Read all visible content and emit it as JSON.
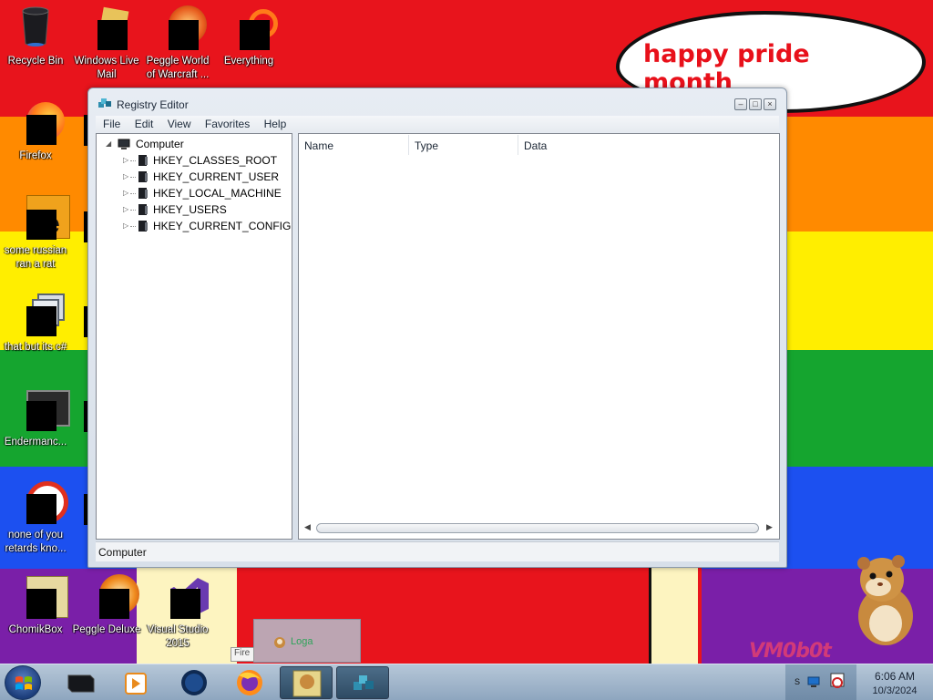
{
  "speech_bubble": {
    "text": "happy pride month"
  },
  "watermark": "VM0b0t",
  "desktop_icons": [
    {
      "label": "Recycle Bin"
    },
    {
      "label": "Windows Live Mail"
    },
    {
      "label": "Peggle World of Warcraft ..."
    },
    {
      "label": "Everything"
    },
    {
      "label": "Firefox"
    },
    {
      "label": "some russian ran a rat"
    },
    {
      "label": "that but its c#"
    },
    {
      "label": "Endermanc..."
    },
    {
      "label": "none of you retards kno..."
    },
    {
      "label": "ChomikBox"
    },
    {
      "label": "Peggle Deluxe"
    },
    {
      "label": "Visual Studio 2015"
    }
  ],
  "regedit": {
    "title": "Registry Editor",
    "menu": [
      "File",
      "Edit",
      "View",
      "Favorites",
      "Help"
    ],
    "tree": {
      "root": "Computer",
      "hives": [
        "HKEY_CLASSES_ROOT",
        "HKEY_CURRENT_USER",
        "HKEY_LOCAL_MACHINE",
        "HKEY_USERS",
        "HKEY_CURRENT_CONFIG"
      ]
    },
    "columns": [
      "Name",
      "Type",
      "Data"
    ],
    "status": "Computer"
  },
  "drag_preview": {
    "label": "Loga",
    "tooltip": "Fire"
  },
  "taskbar": {
    "items": [
      "terminal",
      "media-player",
      "globe",
      "firefox",
      "chomikbox",
      "regedit"
    ],
    "tray_text": "S",
    "time": "6:06 AM",
    "date": "10/3/2024"
  },
  "colors": {
    "pride": [
      "#e8141c",
      "#ff8a00",
      "#ffee00",
      "#15a52f",
      "#1c50f0",
      "#7a1fa8"
    ],
    "bubble_text": "#e8101a"
  }
}
